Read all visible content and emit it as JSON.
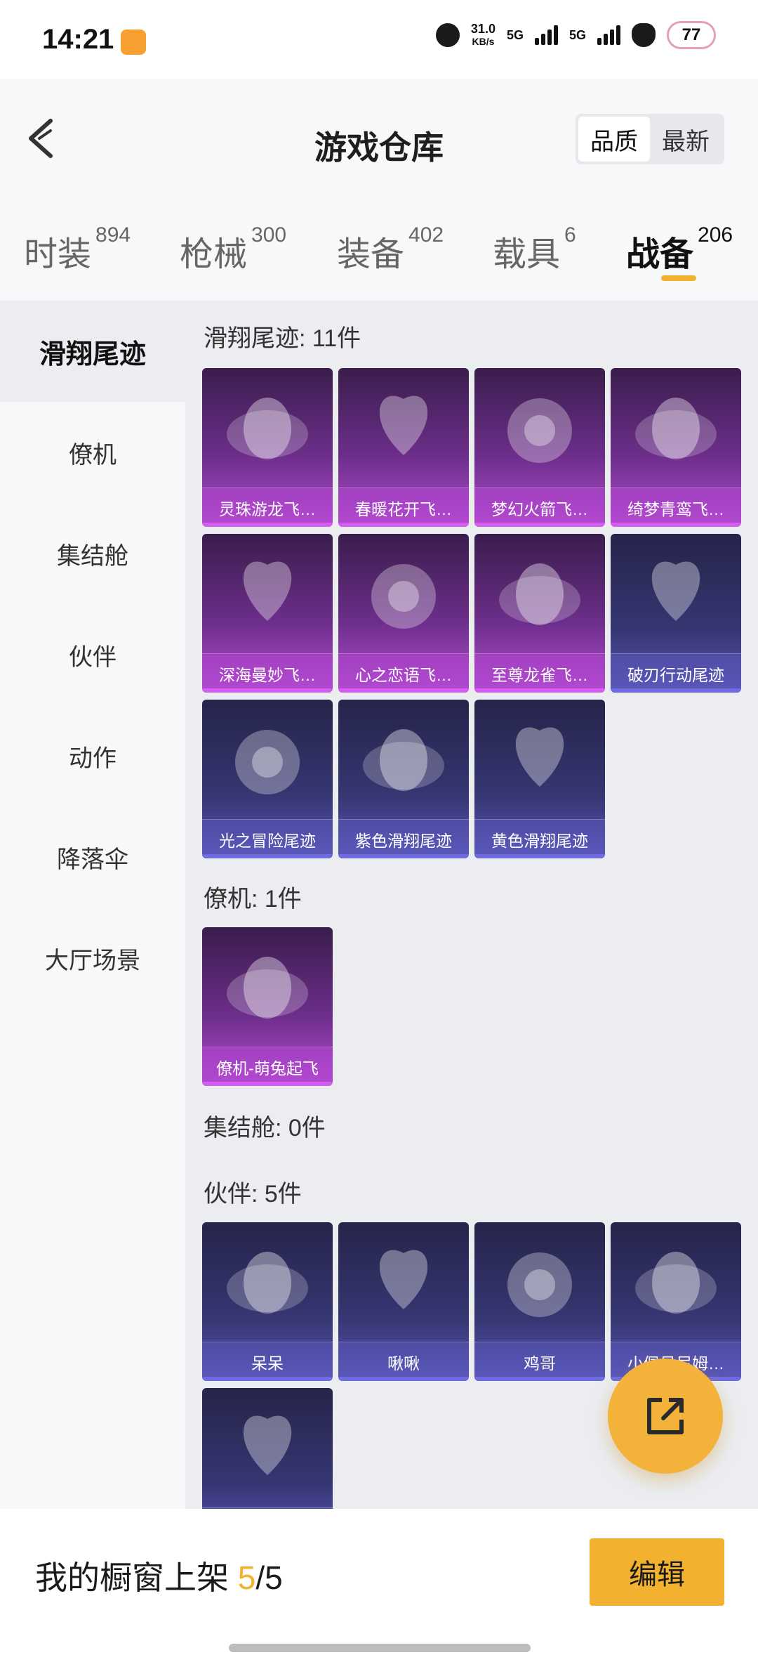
{
  "status_bar": {
    "time": "14:21",
    "speed_value": "31.0",
    "speed_unit": "KB/s",
    "net1": "5G",
    "net2": "5G",
    "battery": "77"
  },
  "header": {
    "title": "游戏仓库",
    "sort_options": [
      "品质",
      "最新"
    ],
    "sort_selected": "品质"
  },
  "tabs": [
    {
      "label": "时装",
      "count": "894"
    },
    {
      "label": "枪械",
      "count": "300"
    },
    {
      "label": "装备",
      "count": "402"
    },
    {
      "label": "载具",
      "count": "6"
    },
    {
      "label": "战备",
      "count": "206",
      "active": true
    }
  ],
  "left_nav": [
    {
      "label": "滑翔尾迹",
      "active": true
    },
    {
      "label": "僚机"
    },
    {
      "label": "集结舱"
    },
    {
      "label": "伙伴"
    },
    {
      "label": "动作"
    },
    {
      "label": "降落伞"
    },
    {
      "label": "大厅场景"
    }
  ],
  "sections": [
    {
      "title": "滑翔尾迹: 11件",
      "items": [
        {
          "name": "灵珠游龙飞…",
          "style": "pink"
        },
        {
          "name": "春暖花开飞…",
          "style": "pink"
        },
        {
          "name": "梦幻火箭飞…",
          "style": "pink"
        },
        {
          "name": "绮梦青鸾飞…",
          "style": "pink"
        },
        {
          "name": "深海曼妙飞…",
          "style": "pink"
        },
        {
          "name": "心之恋语飞…",
          "style": "pink"
        },
        {
          "name": "至尊龙雀飞…",
          "style": "pink"
        },
        {
          "name": "破刃行动尾迹",
          "style": "blue"
        },
        {
          "name": "光之冒险尾迹",
          "style": "blue"
        },
        {
          "name": "紫色滑翔尾迹",
          "style": "blue"
        },
        {
          "name": "黄色滑翔尾迹",
          "style": "blue"
        }
      ]
    },
    {
      "title": "僚机: 1件",
      "items": [
        {
          "name": "僚机-萌兔起飞",
          "style": "pink"
        }
      ]
    },
    {
      "title": "集结舱: 0件",
      "items": []
    },
    {
      "title": "伙伴: 5件",
      "items": [
        {
          "name": "呆呆",
          "style": "blue"
        },
        {
          "name": "啾啾",
          "style": "blue"
        },
        {
          "name": "鸡哥",
          "style": "blue"
        },
        {
          "name": "小佩贝尼姆…",
          "style": "blue"
        },
        {
          "name": "",
          "style": "blue"
        }
      ]
    }
  ],
  "bottom_bar": {
    "label": "我的橱窗上架 ",
    "current": "5",
    "separator": "/",
    "total": "5",
    "edit_label": "编辑"
  },
  "colors": {
    "accent": "#f2b230",
    "card_pink": "#b14ccf",
    "card_blue": "#5a55b8"
  }
}
